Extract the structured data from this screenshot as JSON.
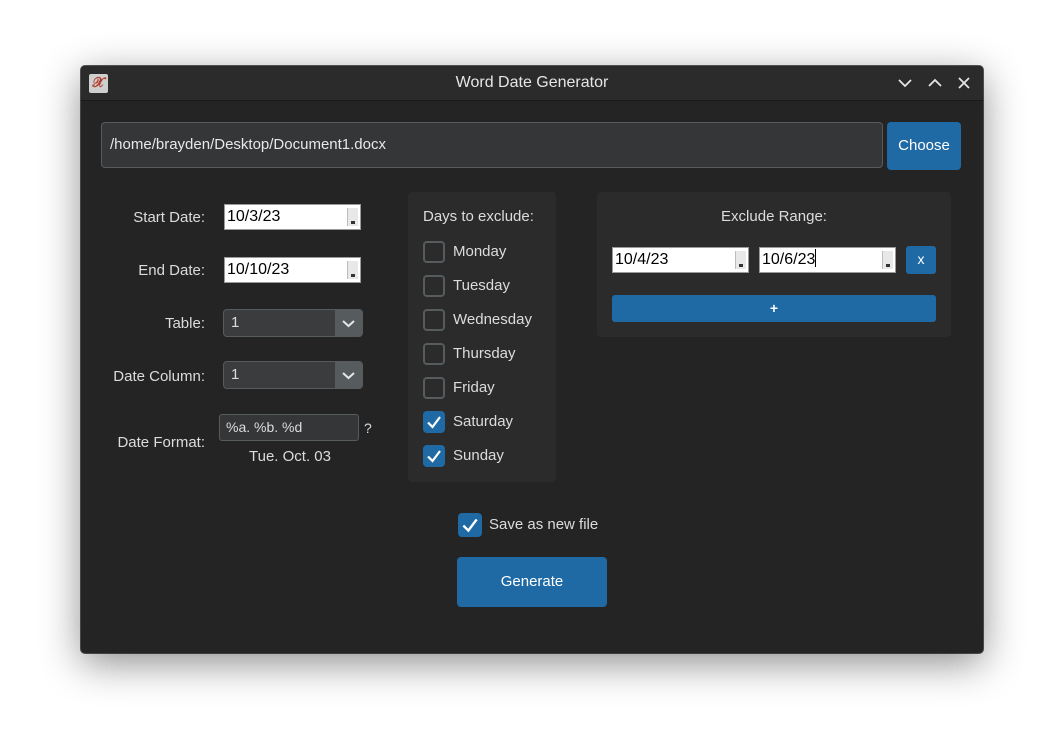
{
  "window": {
    "title": "Word Date Generator",
    "app_icon": "x-icon"
  },
  "file": {
    "path": "/home/brayden/Desktop/Document1.docx",
    "choose_label": "Choose"
  },
  "form": {
    "start_date_label": "Start Date:",
    "start_date_value": "10/3/23",
    "end_date_label": "End Date:",
    "end_date_value": "10/10/23",
    "table_label": "Table:",
    "table_value": "1",
    "date_column_label": "Date Column:",
    "date_column_value": "1",
    "date_format_label": "Date Format:",
    "date_format_value": "%a. %b. %d",
    "date_format_help": "?",
    "date_format_preview": "Tue. Oct. 03"
  },
  "days": {
    "title": "Days to exclude:",
    "items": [
      {
        "label": "Monday",
        "checked": false
      },
      {
        "label": "Tuesday",
        "checked": false
      },
      {
        "label": "Wednesday",
        "checked": false
      },
      {
        "label": "Thursday",
        "checked": false
      },
      {
        "label": "Friday",
        "checked": false
      },
      {
        "label": "Saturday",
        "checked": true
      },
      {
        "label": "Sunday",
        "checked": true
      }
    ]
  },
  "exclude_range": {
    "title": "Exclude Range:",
    "from_value": "10/4/23",
    "to_value": "10/6/23",
    "remove_label": "x",
    "add_label": "+"
  },
  "options": {
    "save_as_new_label": "Save as new file",
    "save_as_new_checked": true
  },
  "actions": {
    "generate_label": "Generate"
  },
  "colors": {
    "accent": "#1f6aa5",
    "window_bg": "#242424",
    "panel_bg": "#2b2b2b"
  }
}
